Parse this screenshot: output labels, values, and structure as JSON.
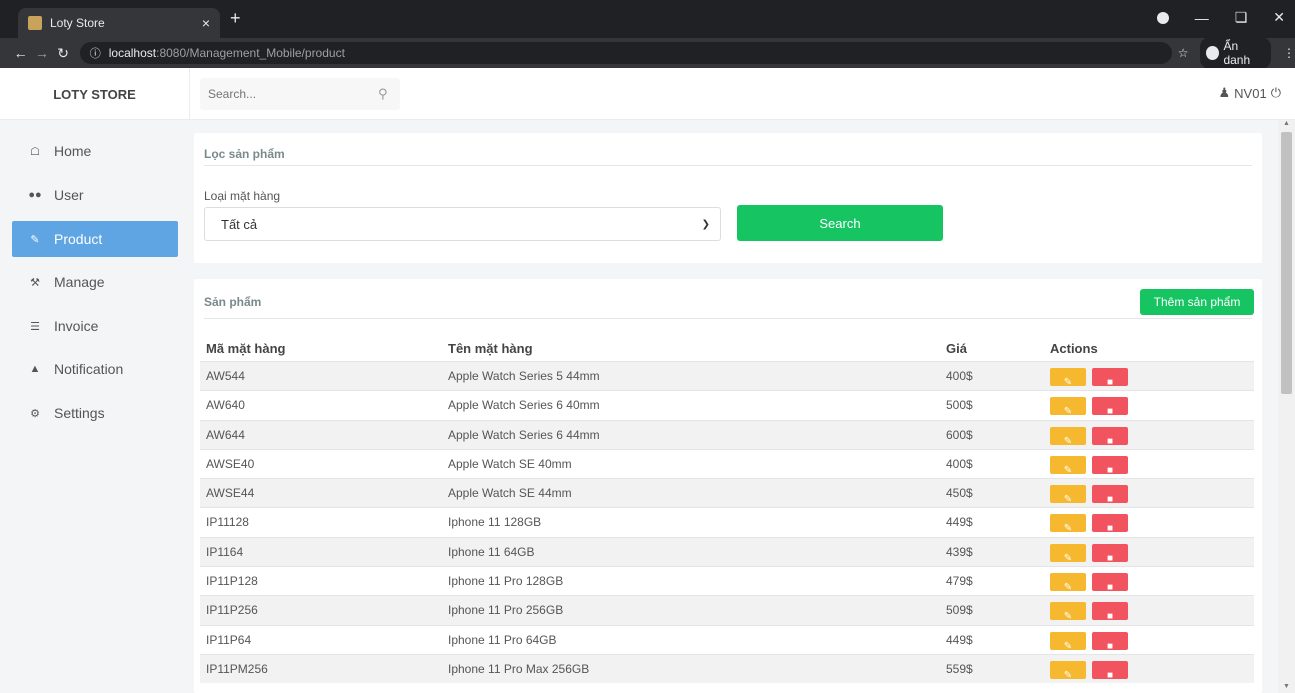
{
  "browser": {
    "tab_title": "Loty Store",
    "tab_close": "×",
    "new_tab": "+",
    "url_host": "localhost",
    "url_path": ":8080/Management_Mobile/product",
    "incognito_label": "Ẩn danh"
  },
  "header": {
    "brand": "LOTY STORE",
    "search_placeholder": "Search...",
    "user": "NV01"
  },
  "sidebar": {
    "items": [
      {
        "label": "Home",
        "icon": "home-icon",
        "active": false
      },
      {
        "label": "User",
        "icon": "users-icon",
        "active": false
      },
      {
        "label": "Product",
        "icon": "edit-icon",
        "active": true
      },
      {
        "label": "Manage",
        "icon": "wrench-icon",
        "active": false
      },
      {
        "label": "Invoice",
        "icon": "list-icon",
        "active": false
      },
      {
        "label": "Notification",
        "icon": "bell-icon",
        "active": false
      },
      {
        "label": "Settings",
        "icon": "cogs-icon",
        "active": false
      }
    ]
  },
  "filter": {
    "title": "Lọc sản phẩm",
    "category_label": "Loại mặt hàng",
    "category_value": "Tất cả",
    "search_button": "Search"
  },
  "products": {
    "title": "Sản phẩm",
    "add_button": "Thêm sản phẩm",
    "columns": [
      "Mã mặt hàng",
      "Tên mặt hàng",
      "Giá",
      "Actions"
    ],
    "rows": [
      {
        "code": "AW544",
        "name": "Apple Watch Series 5 44mm",
        "price": "400$"
      },
      {
        "code": "AW640",
        "name": "Apple Watch Series 6 40mm",
        "price": "500$"
      },
      {
        "code": "AW644",
        "name": "Apple Watch Series 6 44mm",
        "price": "600$"
      },
      {
        "code": "AWSE40",
        "name": "Apple Watch SE 40mm",
        "price": "400$"
      },
      {
        "code": "AWSE44",
        "name": "Apple Watch SE 44mm",
        "price": "450$"
      },
      {
        "code": "IP11128",
        "name": "Iphone 11 128GB",
        "price": "449$"
      },
      {
        "code": "IP1164",
        "name": "Iphone 11 64GB",
        "price": "439$"
      },
      {
        "code": "IP11P128",
        "name": "Iphone 11 Pro 128GB",
        "price": "479$"
      },
      {
        "code": "IP11P256",
        "name": "Iphone 11 Pro 256GB",
        "price": "509$"
      },
      {
        "code": "IP11P64",
        "name": "Iphone 11 Pro 64GB",
        "price": "449$"
      },
      {
        "code": "IP11PM256",
        "name": "Iphone 11 Pro Max 256GB",
        "price": "559$"
      }
    ]
  },
  "colors": {
    "accent_green": "#16c462",
    "active_blue": "#5fa4e3",
    "edit_yellow": "#f5b82e",
    "delete_red": "#f1535f"
  }
}
